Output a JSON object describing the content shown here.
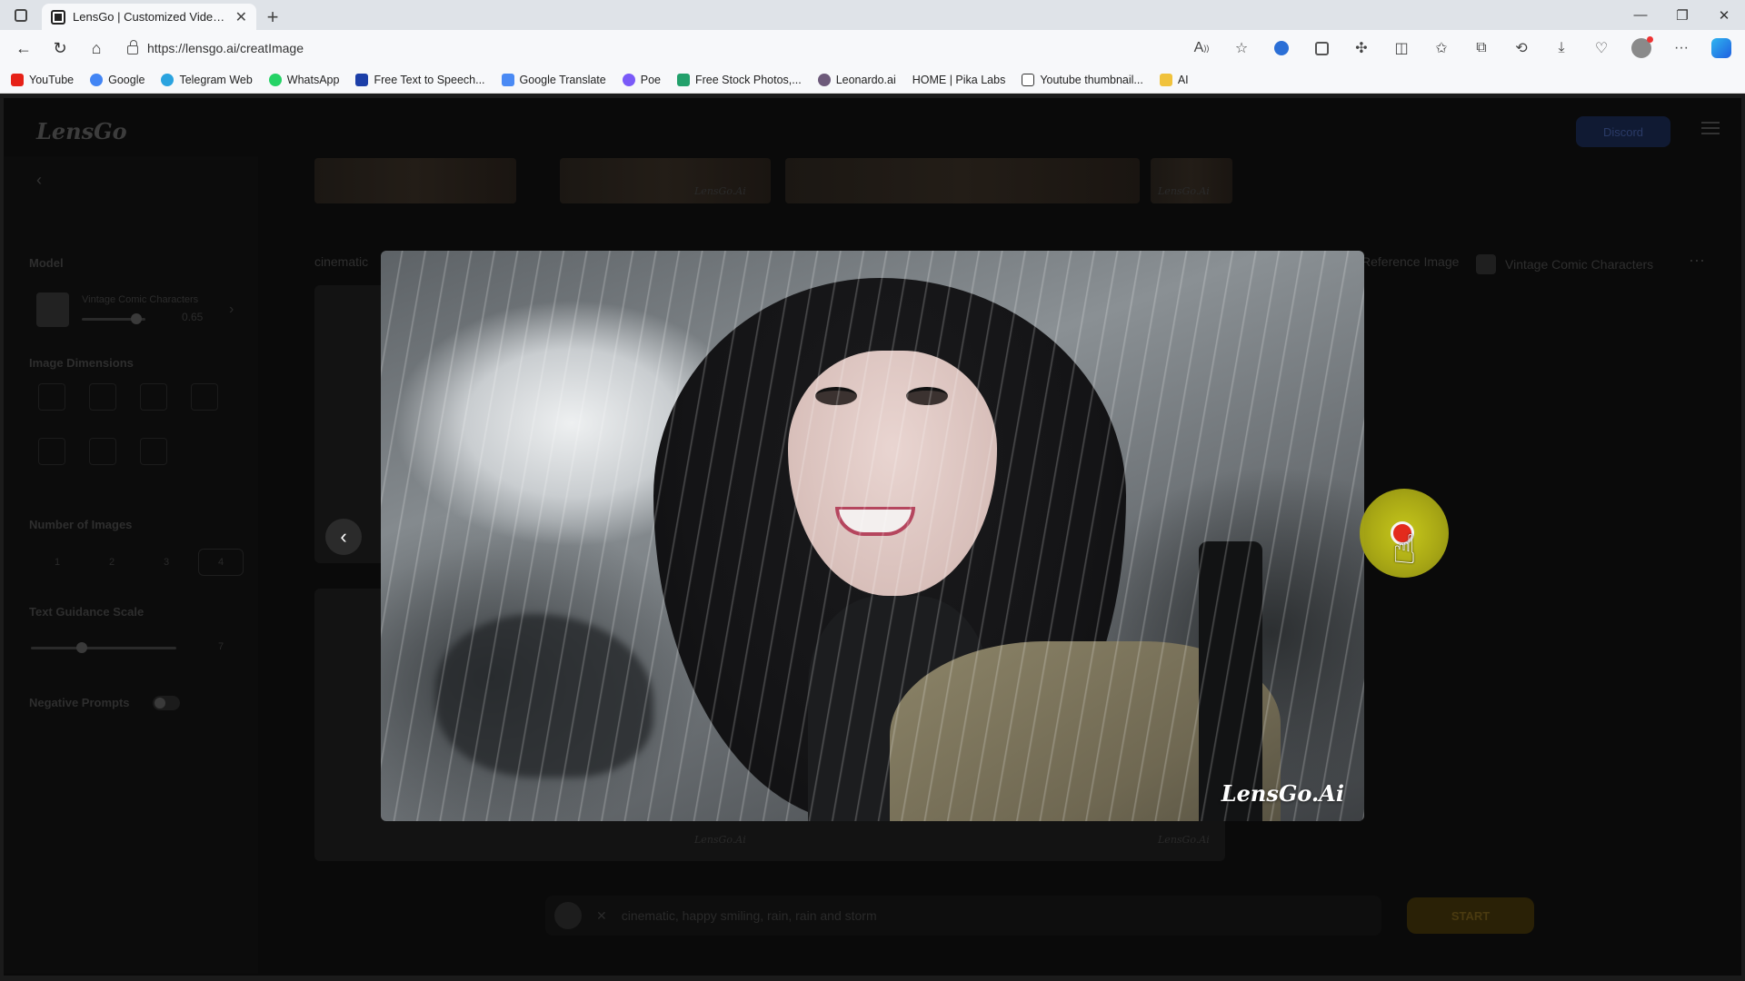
{
  "browser": {
    "tab_title": "LensGo | Customized Video Mak",
    "url": "https://lensgo.ai/creatImage",
    "bookmarks": [
      {
        "label": "YouTube",
        "color": "#e62117"
      },
      {
        "label": "Google",
        "color": "#4285f4"
      },
      {
        "label": "Telegram Web",
        "color": "#2aa3df"
      },
      {
        "label": "WhatsApp",
        "color": "#25d366"
      },
      {
        "label": "Free Text to Speech...",
        "color": "#1c3fa8"
      },
      {
        "label": "Google Translate",
        "color": "#4a8af4"
      },
      {
        "label": "Poe",
        "color": "#7a5af8"
      },
      {
        "label": "Free Stock Photos,...",
        "color": "#22a06b"
      },
      {
        "label": "Leonardo.ai",
        "color": "#6d5a7a"
      },
      {
        "label": "HOME | Pika Labs",
        "color": "#f7f8fa"
      },
      {
        "label": "Youtube thumbnail...",
        "color": "#333333"
      },
      {
        "label": "AI",
        "color": "#f0c23c"
      }
    ]
  },
  "app": {
    "brand": "LensGo",
    "header_button": "Discord",
    "sidebar": {
      "model_label": "Model",
      "model_name": "Vintage Comic Characters",
      "model_value": "0.65",
      "dimensions_label": "Image Dimensions",
      "count_label": "Number of Images",
      "counts": [
        "1",
        "2",
        "3",
        "4"
      ],
      "guidance_label": "Text Guidance Scale",
      "guidance_value": "7",
      "negative_label": "Negative Prompts"
    },
    "ref_tags": {
      "left": "cinematic",
      "reference": "Reference Image",
      "model": "Vintage Comic Characters"
    },
    "prompt_text": "cinematic, happy smiling, rain, rain and storm",
    "start_label": "START",
    "bg_watermark": "LensGo.Ai"
  },
  "lightbox": {
    "watermark": "LensGo.Ai"
  }
}
